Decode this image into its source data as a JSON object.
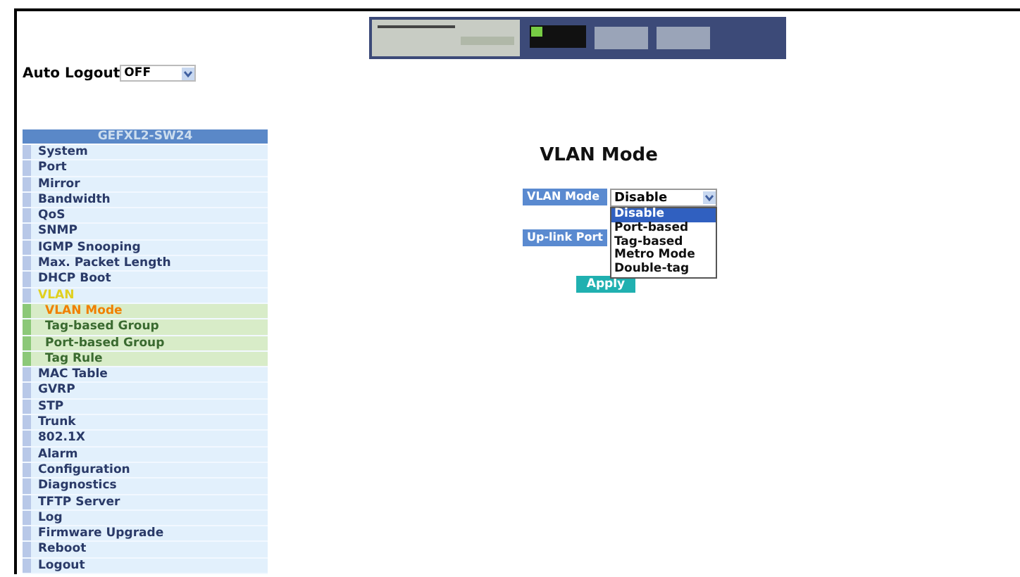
{
  "auto_logout": {
    "label": "Auto Logout",
    "value": "OFF"
  },
  "sidebar": {
    "title": "GEFXL2-SW24",
    "items": [
      {
        "label": "System",
        "selected": false
      },
      {
        "label": "Port",
        "selected": false
      },
      {
        "label": "Mirror",
        "selected": false
      },
      {
        "label": "Bandwidth",
        "selected": false
      },
      {
        "label": "QoS",
        "selected": false
      },
      {
        "label": "SNMP",
        "selected": false
      },
      {
        "label": "IGMP Snooping",
        "selected": false
      },
      {
        "label": "Max. Packet Length",
        "selected": false
      },
      {
        "label": "DHCP Boot",
        "selected": false
      },
      {
        "label": "VLAN",
        "selected": true,
        "expanded": true,
        "children": [
          {
            "label": "VLAN Mode",
            "selected": true
          },
          {
            "label": "Tag-based Group",
            "selected": false
          },
          {
            "label": "Port-based Group",
            "selected": false
          },
          {
            "label": "Tag Rule",
            "selected": false
          }
        ]
      },
      {
        "label": "MAC Table",
        "selected": false
      },
      {
        "label": "GVRP",
        "selected": false
      },
      {
        "label": "STP",
        "selected": false
      },
      {
        "label": "Trunk",
        "selected": false
      },
      {
        "label": "802.1X",
        "selected": false
      },
      {
        "label": "Alarm",
        "selected": false
      },
      {
        "label": "Configuration",
        "selected": false
      },
      {
        "label": "Diagnostics",
        "selected": false
      },
      {
        "label": "TFTP Server",
        "selected": false
      },
      {
        "label": "Log",
        "selected": false
      },
      {
        "label": "Firmware Upgrade",
        "selected": false
      },
      {
        "label": "Reboot",
        "selected": false
      },
      {
        "label": "Logout",
        "selected": false
      }
    ]
  },
  "main": {
    "title": "VLAN Mode",
    "vlan_mode": {
      "label": "VLAN Mode",
      "value": "Disable",
      "expanded": true,
      "options": [
        {
          "label": "Disable",
          "selected": true
        },
        {
          "label": "Port-based",
          "selected": false
        },
        {
          "label": "Tag-based",
          "selected": false
        },
        {
          "label": "Metro Mode",
          "selected": false
        },
        {
          "label": "Double-tag",
          "selected": false
        }
      ]
    },
    "uplink": {
      "label": "Up-link Port"
    },
    "apply": "Apply"
  }
}
